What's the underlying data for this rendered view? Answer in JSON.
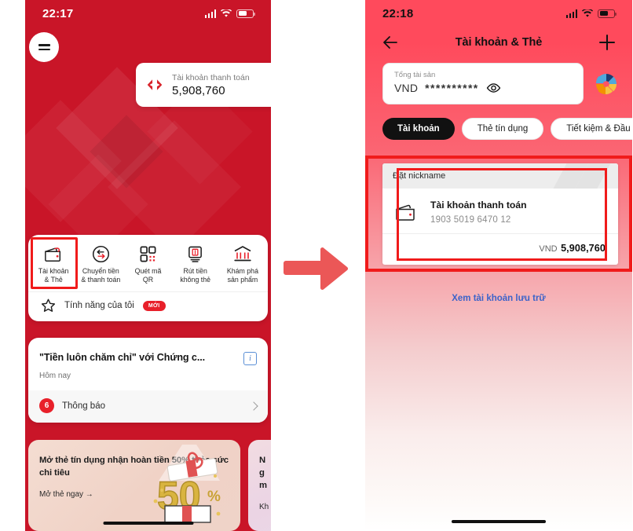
{
  "meta": {
    "accent_red": "#C91528",
    "highlight_red": "#F01B1B",
    "arrow_color": "#EB5757",
    "link_blue": "#3C63C9"
  },
  "left_phone": {
    "status_bar": {
      "time": "22:17",
      "signal_icon": "cellular-signal-icon",
      "wifi_icon": "wifi-icon",
      "battery_icon": "battery-icon"
    },
    "menu_button": {
      "name": "hamburger-menu-button"
    },
    "balance_pill": {
      "logo_icon": "techcombank-logo-icon",
      "label": "Tài khoản thanh toán",
      "value": "5,908,760"
    },
    "nav_items": [
      {
        "icon": "wallet-card-icon",
        "line1": "Tài khoản",
        "line2": "& Thẻ",
        "highlighted": true
      },
      {
        "icon": "transfer-money-icon",
        "line1": "Chuyển tiền",
        "line2": "& thanh toán",
        "highlighted": false
      },
      {
        "icon": "qr-scan-icon",
        "line1": "Quét mã",
        "line2": "QR",
        "highlighted": false
      },
      {
        "icon": "cardless-atm-icon",
        "line1": "Rút tiền",
        "line2": "không thẻ",
        "highlighted": false
      },
      {
        "icon": "bank-explore-icon",
        "line1": "Khám phá",
        "line2": "sản phẩm",
        "highlighted": false
      }
    ],
    "feature_row": {
      "icon": "star-icon",
      "label": "Tính năng của tôi",
      "badge": "MỚI"
    },
    "news_card": {
      "title": "\"Tiền luôn chăm chỉ\" với Chứng c...",
      "subtitle": "Hôm nay",
      "info_icon": "info-icon",
      "notification_count": "6",
      "notification_label": "Thông báo",
      "chevron_icon": "chevron-right-icon"
    },
    "promos": [
      {
        "heading": "Mở thẻ tín dụng nhận hoàn tiền 50% thỏa sức chi tiêu",
        "cta": "Mở thẻ ngay →",
        "art": "gift-50-percent-icon"
      },
      {
        "heading": "N\ng\nm",
        "cta": "Kh",
        "art": "promo-art-icon"
      }
    ]
  },
  "right_phone": {
    "status_bar": {
      "time": "22:18",
      "signal_icon": "cellular-signal-icon",
      "wifi_icon": "wifi-icon",
      "battery_icon": "battery-icon"
    },
    "app_bar": {
      "back_icon": "back-arrow-icon",
      "title": "Tài khoản & Thẻ",
      "add_icon": "plus-icon"
    },
    "total_assets": {
      "label": "Tổng tài sản",
      "currency": "VND",
      "masked_value": "**********",
      "eye_icon": "eye-icon"
    },
    "brand_logo_icon": "circular-brand-logo-icon",
    "tabs": [
      {
        "label": "Tài khoản",
        "active": true
      },
      {
        "label": "Thẻ tín dụng",
        "active": false
      },
      {
        "label": "Tiết kiệm & Đầu t",
        "active": false
      }
    ],
    "account_card": {
      "nickname_label": "Đặt nickname",
      "wallet_icon": "wallet-card-icon",
      "name": "Tài khoản thanh toán",
      "number": "1903 5019 6470 12",
      "currency": "VND",
      "balance": "5,908,760"
    },
    "archive_link": "Xem tài khoản lưu trữ"
  },
  "flow_arrow": {
    "name": "flow-arrow-icon"
  }
}
